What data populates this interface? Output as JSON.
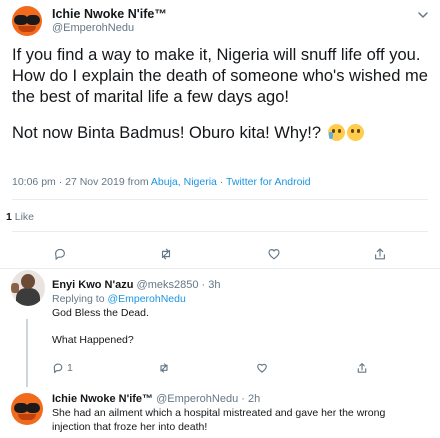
{
  "main_tweet": {
    "author_name": "Ichie Nwoke N'ife™",
    "author_handle": "@EmperohNedu",
    "paragraph_1": "If you find a way to make it, Nigeria will snuff life off you. How do I explain the death of someone who's wished me the best of marital life a few days ago!",
    "paragraph_2": "Not now Binta Badmus! Oburo kita! Why!?",
    "time": "10:06 pm · 27 Nov 2019 from ",
    "location": "Abuja, Nigeria",
    "separator": " · ",
    "source": "Twitter for Android",
    "likes_count": "1",
    "likes_label": " Like",
    "emojis": [
      "crying-face-emoji",
      "sad-face-emoji"
    ]
  },
  "replies": [
    {
      "author_name": "Enyi Kwo N'azu",
      "author_handle": "@meks2850",
      "time": " · 3h",
      "replying_prefix": "Replying to ",
      "replying_handle": "@EmperohNedu",
      "line_1": "God Bless the Dead.",
      "line_2": "What Happened?",
      "reply_count": "1"
    },
    {
      "author_name": "Ichie Nwoke N'ife™",
      "author_handle": "@EmperohNedu",
      "time": " · 2h",
      "line_1": "She had an ailment which a hospital mistreated and gave her the wrong",
      "line_2": "injection that froze her into death!"
    }
  ],
  "colors": {
    "link": "#1b95e0",
    "secondary_text": "#657786",
    "avatar_orange": "#f26a1c"
  }
}
